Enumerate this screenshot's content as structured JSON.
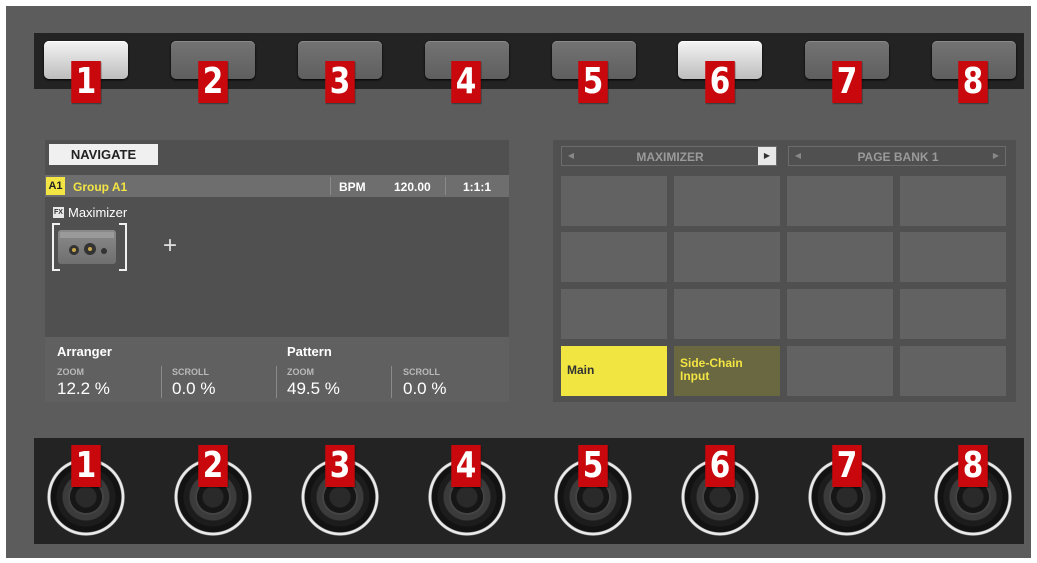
{
  "buttons": {
    "numbers": [
      "1",
      "2",
      "3",
      "4",
      "5",
      "6",
      "7",
      "8"
    ],
    "lit": [
      true,
      false,
      false,
      false,
      false,
      true,
      false,
      false
    ]
  },
  "knobs": {
    "numbers": [
      "1",
      "2",
      "3",
      "4",
      "5",
      "6",
      "7",
      "8"
    ]
  },
  "left_display": {
    "tab": "NAVIGATE",
    "group_badge": "A1",
    "group_name": "Group A1",
    "bpm_label": "BPM",
    "bpm_value": "120.00",
    "position": "1:1:1",
    "fx_icon": "FX",
    "plugin_name": "Maximizer",
    "add_symbol": "+",
    "arranger": {
      "title": "Arranger",
      "zoom_label": "ZOOM",
      "zoom_value": "12.2 %",
      "scroll_label": "SCROLL",
      "scroll_value": "0.0 %"
    },
    "pattern": {
      "title": "Pattern",
      "zoom_label": "ZOOM",
      "zoom_value": "49.5 %",
      "scroll_label": "SCROLL",
      "scroll_value": "0.0 %"
    }
  },
  "right_display": {
    "plugin_header": "MAXIMIZER",
    "page_header": "PAGE BANK 1",
    "pads": {
      "main": "Main",
      "sidechain_line1": "Side-Chain",
      "sidechain_line2": "Input"
    }
  },
  "colors": {
    "panel": "#5c5c5c",
    "number_badge": "#c8080d",
    "highlight_yellow": "#f2e544"
  }
}
